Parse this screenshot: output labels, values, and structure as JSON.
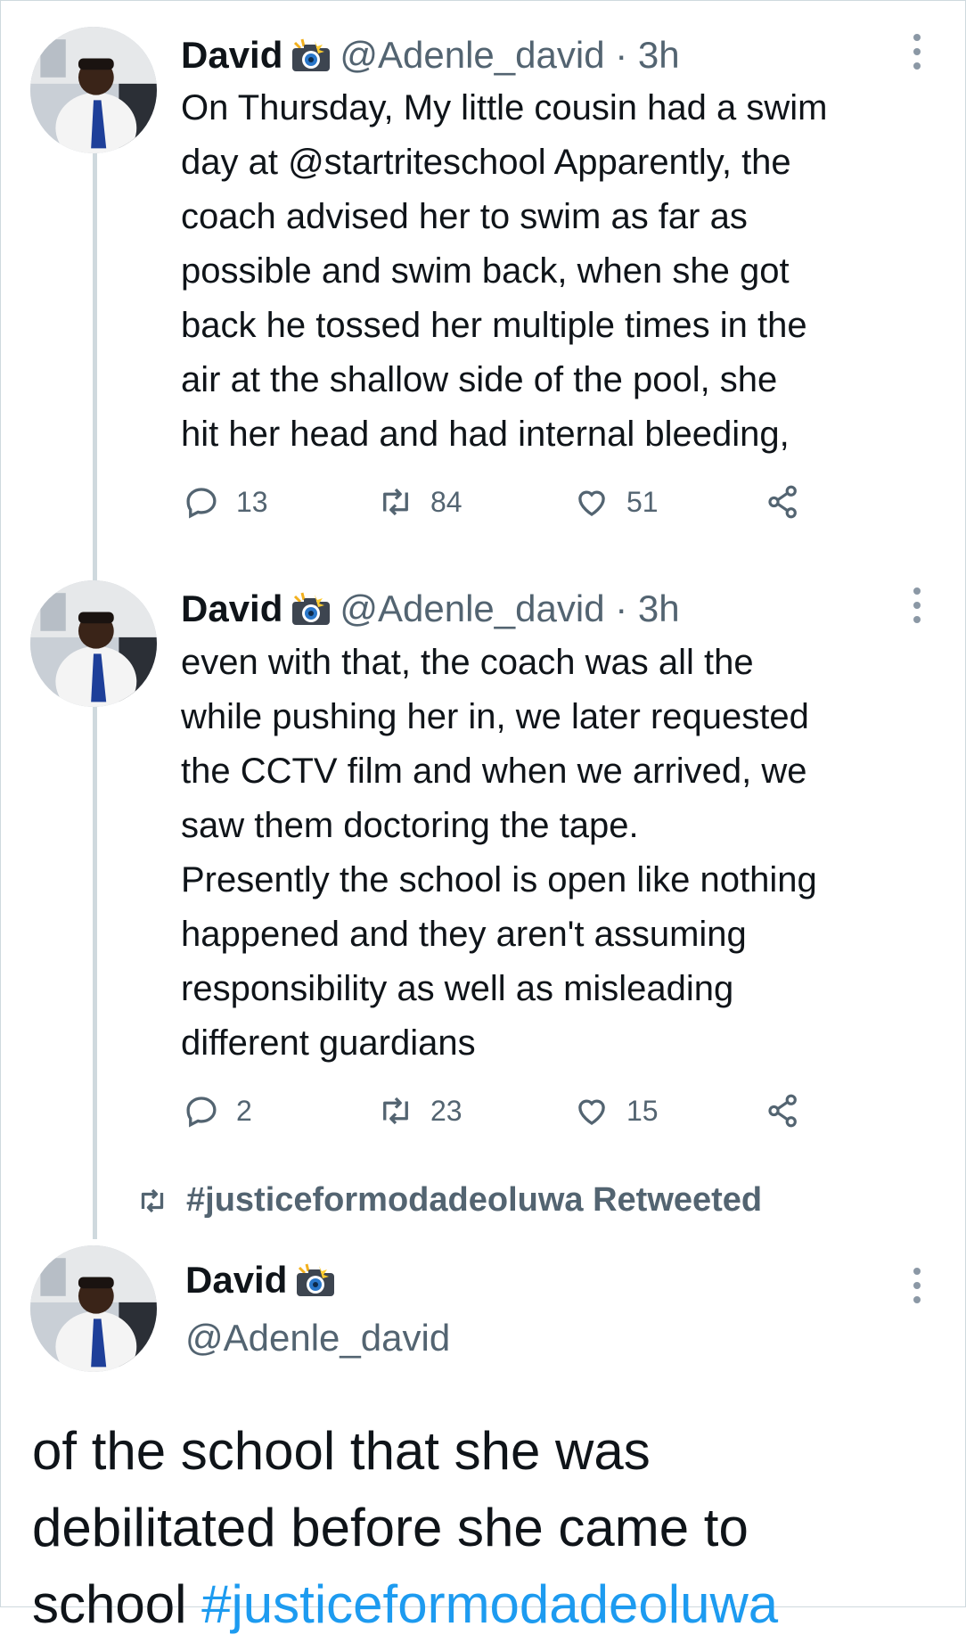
{
  "tweets": [
    {
      "name": "David",
      "badge_icon": "camera-flash-emoji",
      "handle": "@Adenle_david",
      "separator": "·",
      "time": "3h",
      "text": "On Thursday, My little cousin had a swim\nday at @startriteschool Apparently, the\ncoach advised her to swim as far as\npossible and swim back, when she got\nback he tossed her multiple times in the\nair at the shallow side of the pool, she\nhit her head and had internal bleeding,",
      "replies": "13",
      "retweets": "84",
      "likes": "51"
    },
    {
      "name": "David",
      "badge_icon": "camera-flash-emoji",
      "handle": "@Adenle_david",
      "separator": "·",
      "time": "3h",
      "text": "even with that, the coach was all the\nwhile pushing her in, we later requested\nthe CCTV film and when we arrived, we\nsaw them doctoring the tape.\nPresently the school is open like nothing\nhappened and they aren't assuming\nresponsibility as well as misleading\ndifferent guardians",
      "replies": "2",
      "retweets": "23",
      "likes": "15"
    }
  ],
  "retweet_context": {
    "label": "#justiceformodadeoluwa Retweeted"
  },
  "main_tweet": {
    "name": "David",
    "badge_icon": "camera-flash-emoji",
    "handle": "@Adenle_david",
    "text": "of the school that she was\ndebilitated before she came to\nschool ",
    "hashtag": "#justiceformodadeoluwa"
  },
  "colors": {
    "text": "#0f1419",
    "secondary": "#536471",
    "link": "#1d9bf0",
    "thread_line": "#cfd9de"
  }
}
